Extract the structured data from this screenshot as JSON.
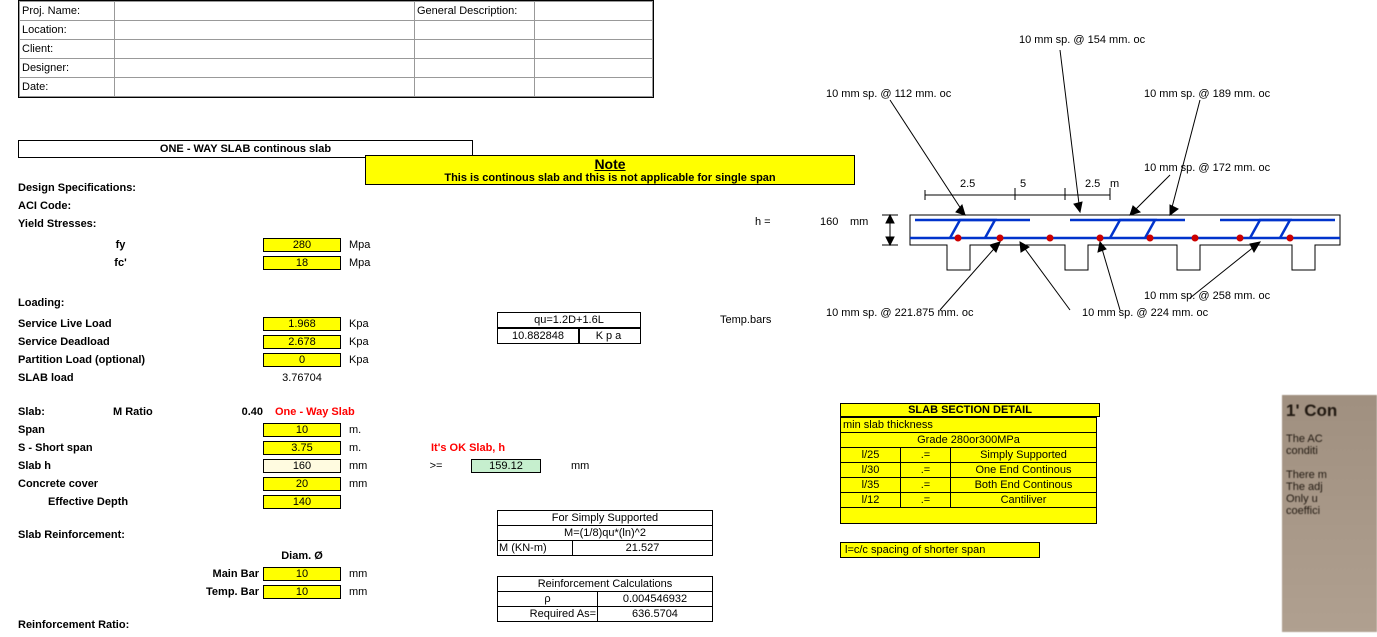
{
  "header": {
    "projName": "Proj. Name:",
    "location": "Location:",
    "client": "Client:",
    "designer": "Designer:",
    "date": "Date:",
    "genDesc": "General Description:"
  },
  "title": "ONE - WAY SLAB continous slab",
  "note": {
    "title": "Note",
    "body": "This is continous slab and this is not applicable for single span"
  },
  "spec": {
    "heading": "Design Specifications:",
    "aci": "ACI Code:",
    "yield": "Yield Stresses:",
    "fy_label": "fy",
    "fy_val": "280",
    "fy_unit": "Mpa",
    "fc_label": "fc'",
    "fc_val": "18",
    "fc_unit": "Mpa"
  },
  "loading": {
    "heading": "Loading:",
    "live": "Service Live Load",
    "live_val": "1.968",
    "live_unit": "Kpa",
    "dead": "Service Deadload",
    "dead_val": "2.678",
    "dead_unit": "Kpa",
    "part": "Partition Load (optional)",
    "part_val": "0",
    "part_unit": "Kpa",
    "slab": "SLAB load",
    "slab_val": "3.76704"
  },
  "qu": {
    "formula": "qu=1.2D+1.6L",
    "val": "10.882848",
    "unit": "Kpa",
    "temp_label": "Temp.bars"
  },
  "slabDim": {
    "heading": "Slab:",
    "mratio_label": "M Ratio",
    "mratio_val": "0.40",
    "type": "One - Way Slab",
    "span_label": "Span",
    "span_val": "10",
    "span_unit": "m.",
    "short_label": "S - Short span",
    "short_val": "3.75",
    "short_unit": "m.",
    "ok": "It's OK Slab, h",
    "h_label": "Slab h",
    "h_val": "160",
    "h_unit": "mm",
    "h_ge": ">=",
    "h_req": "159.12",
    "h_req_unit": "mm",
    "cover_label": "Concrete cover",
    "cover_val": "20",
    "cover_unit": "mm",
    "eff_label": "Effective Depth",
    "eff_val": "140"
  },
  "reinf": {
    "heading": "Slab Reinforcement:",
    "diam": "Diam. Ø",
    "main": "Main Bar",
    "main_val": "10",
    "main_unit": "mm",
    "temp": "Temp. Bar",
    "temp_val": "10",
    "temp_unit": "mm",
    "ratio": "Reinforcement Ratio:"
  },
  "ss": {
    "title": "For Simply Supported",
    "formula": "M=(1/8)qu*(ln)^2",
    "m_label": "M (KN-m)",
    "m_val": "21.527",
    "calc_title": "Reinforcement Calculations",
    "rho_label": "ρ",
    "rho_val": "0.004546932",
    "as_label": "Required As=",
    "as_val": "636.5704"
  },
  "section": {
    "title": "SLAB SECTION DETAIL",
    "minThick": "min slab thickness",
    "grade": "Grade 280or300MPa",
    "rows": [
      {
        "r": "l/25",
        "eq": ".=",
        "desc": "Simply Supported"
      },
      {
        "r": "l/30",
        "eq": ".=",
        "desc": "One End Continous"
      },
      {
        "r": "l/35",
        "eq": ".=",
        "desc": "Both End Continous"
      },
      {
        "r": "l/12",
        "eq": ".=",
        "desc": "Cantiliver"
      }
    ],
    "note": "l=c/c spacing of shorter span"
  },
  "diagram": {
    "h_label": "h =",
    "h_val": "160",
    "h_unit": "mm",
    "dim1": "2.5",
    "dim2": "5",
    "dim3": "2.5",
    "dim_unit": "m",
    "annot": {
      "top1": "10 mm sp. @   154 mm. oc",
      "left1": "10 mm sp. @   112 mm. oc",
      "right1": "10 mm sp. @   189 mm. oc",
      "right2": "10 mm sp. @   172 mm. oc",
      "bot_l": "10 mm sp. @   221.875 mm. oc",
      "bot_m": "10 mm sp. @   224   mm. oc",
      "bot_r": "10 mm sp. @   258 mm. oc"
    }
  },
  "book": {
    "l1": "1' Con",
    "l2": "The AC",
    "l3": "conditi",
    "l4": "There m",
    "l5": "The adj",
    "l6": "Only u",
    "l7": "coeffici"
  }
}
